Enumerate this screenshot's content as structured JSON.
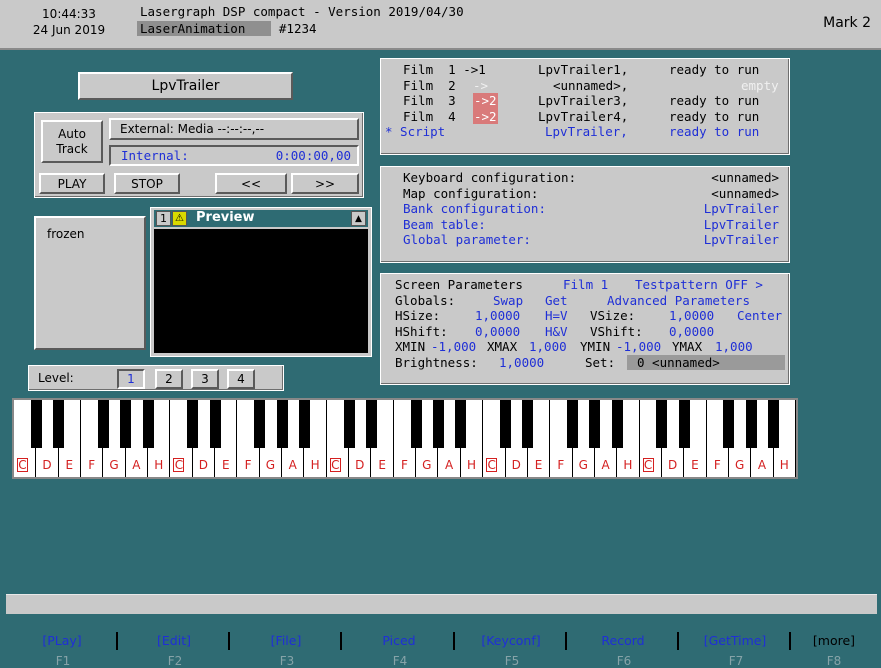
{
  "header": {
    "time": "10:44:33",
    "date": "24 Jun 2019",
    "title": "Lasergraph DSP compact - Version 2019/04/30",
    "app": "LaserAnimation",
    "id": "#1234",
    "mark": "Mark 2"
  },
  "trailer_button": "LpvTrailer",
  "transport": {
    "auto_track": [
      "Auto",
      "Track"
    ],
    "external": "External: Media --:--:--,--",
    "internal_label": "Internal:",
    "internal_value": "0:00:00,00",
    "play": "PLAY",
    "stop": "STOP",
    "prev": "<<",
    "next": ">>"
  },
  "frozen": "frozen",
  "preview": {
    "number": "1",
    "title": "Preview"
  },
  "films": [
    {
      "label": "Film  1 ->1",
      "name": "LpvTrailer1,",
      "status": "ready to run"
    },
    {
      "label": "Film  2",
      "arrow": "->",
      "name": "<unnamed>,",
      "status": "empty"
    },
    {
      "label": "Film  3",
      "arrow": "->2",
      "name": "LpvTrailer3,",
      "status": "ready to run"
    },
    {
      "label": "Film  4",
      "arrow": "->2",
      "name": "LpvTrailer4,",
      "status": "ready to run"
    },
    {
      "label": "* Script",
      "name": "LpvTrailer,",
      "status": "ready to run"
    }
  ],
  "config": [
    {
      "label": "Keyboard configuration:",
      "value": "<unnamed>"
    },
    {
      "label": "Map configuration:",
      "value": "<unnamed>"
    },
    {
      "label": "Bank configuration:",
      "value": "LpvTrailer"
    },
    {
      "label": "Beam table:",
      "value": "LpvTrailer"
    },
    {
      "label": "Global parameter:",
      "value": "LpvTrailer"
    }
  ],
  "screen": {
    "title": "Screen Parameters",
    "film": "Film 1",
    "testpattern": "Testpattern OFF >",
    "globals": "Globals:",
    "swap": "Swap",
    "get": "Get",
    "advanced": "Advanced Parameters",
    "hsize_label": "HSize:",
    "hsize": "1,0000",
    "hv": "H=V",
    "vsize_label": "VSize:",
    "vsize": "1,0000",
    "center": "Center",
    "hshift_label": "HShift:",
    "hshift": "0,0000",
    "hav": "H&V",
    "vshift_label": "VShift:",
    "vshift": "0,0000",
    "xmin_label": "XMIN",
    "xmin": "-1,000",
    "xmax_label": "XMAX",
    "xmax": "1,000",
    "ymin_label": "YMIN",
    "ymin": "-1,000",
    "ymax_label": "YMAX",
    "ymax": "1,000",
    "brightness_label": "Brightness:",
    "brightness": "1,0000",
    "set_label": "Set:",
    "set_value": "0 <unnamed>"
  },
  "level": {
    "label": "Level:",
    "buttons": [
      "1",
      "2",
      "3",
      "4"
    ],
    "selected": "1"
  },
  "keys": [
    "C",
    "D",
    "E",
    "F",
    "G",
    "A",
    "H",
    "C",
    "D",
    "E",
    "F",
    "G",
    "A",
    "H",
    "C",
    "D",
    "E",
    "F",
    "G",
    "A",
    "H",
    "C",
    "D",
    "E",
    "F",
    "G",
    "A",
    "H",
    "C",
    "D",
    "E",
    "F",
    "G",
    "A",
    "H"
  ],
  "fkeys": [
    {
      "label": "[PLay]",
      "key": "F1"
    },
    {
      "label": "[Edit]",
      "key": "F2"
    },
    {
      "label": "[File]",
      "key": "F3"
    },
    {
      "label": "Piced",
      "key": "F4"
    },
    {
      "label": "[Keyconf]",
      "key": "F5"
    },
    {
      "label": "Record",
      "key": "F6"
    },
    {
      "label": "[GetTime]",
      "key": "F7"
    },
    {
      "label": "[more]",
      "key": "F8"
    }
  ]
}
